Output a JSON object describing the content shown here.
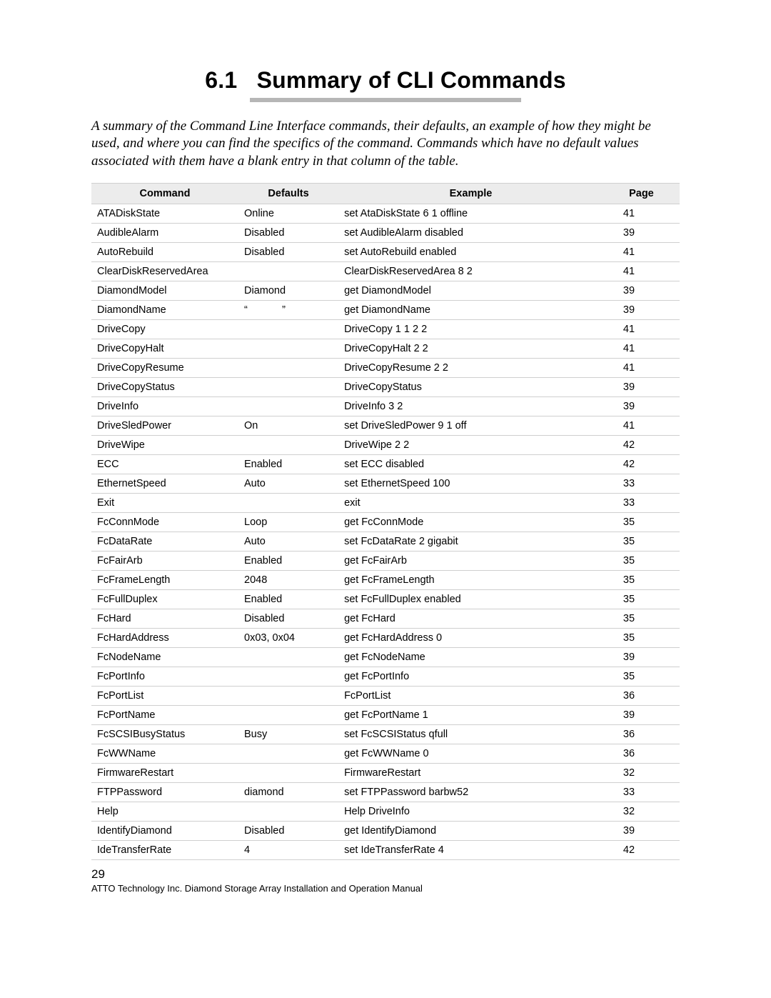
{
  "section": {
    "number": "6.1",
    "title": "Summary of CLI Commands"
  },
  "intro": "A summary of the Command Line Interface commands, their defaults, an example of how they might be used, and where you can find the specifics of the command. Commands which have no default values associated with them have a blank entry in that column of the table.",
  "table": {
    "headers": {
      "command": "Command",
      "defaults": "Defaults",
      "example": "Example",
      "page": "Page"
    },
    "rows": [
      {
        "command": "ATADiskState",
        "defaults": "Online",
        "example": "set AtaDiskState 6 1 offline",
        "page": "41"
      },
      {
        "command": "AudibleAlarm",
        "defaults": "Disabled",
        "example": "set AudibleAlarm disabled",
        "page": "39"
      },
      {
        "command": "AutoRebuild",
        "defaults": "Disabled",
        "example": "set AutoRebuild enabled",
        "page": "41"
      },
      {
        "command": "ClearDiskReservedArea",
        "defaults": "",
        "example": "ClearDiskReservedArea 8 2",
        "page": "41"
      },
      {
        "command": "DiamondModel",
        "defaults": "Diamond",
        "example": "get DiamondModel",
        "page": "39"
      },
      {
        "command": "DiamondName",
        "defaults": "“            ”",
        "example": "get DiamondName",
        "page": "39"
      },
      {
        "command": "DriveCopy",
        "defaults": "",
        "example": "DriveCopy 1 1 2 2",
        "page": "41"
      },
      {
        "command": "DriveCopyHalt",
        "defaults": "",
        "example": "DriveCopyHalt 2 2",
        "page": "41"
      },
      {
        "command": "DriveCopyResume",
        "defaults": "",
        "example": "DriveCopyResume 2 2",
        "page": "41"
      },
      {
        "command": "DriveCopyStatus",
        "defaults": "",
        "example": "DriveCopyStatus",
        "page": "39"
      },
      {
        "command": "DriveInfo",
        "defaults": "",
        "example": "DriveInfo 3 2",
        "page": "39"
      },
      {
        "command": "DriveSledPower",
        "defaults": "On",
        "example": "set DriveSledPower 9 1 off",
        "page": "41"
      },
      {
        "command": "DriveWipe",
        "defaults": "",
        "example": "DriveWipe 2 2",
        "page": "42"
      },
      {
        "command": "ECC",
        "defaults": "Enabled",
        "example": "set ECC disabled",
        "page": "42"
      },
      {
        "command": "EthernetSpeed",
        "defaults": "Auto",
        "example": "set EthernetSpeed 100",
        "page": "33"
      },
      {
        "command": "Exit",
        "defaults": "",
        "example": "exit",
        "page": "33"
      },
      {
        "command": "FcConnMode",
        "defaults": "Loop",
        "example": "get FcConnMode",
        "page": "35"
      },
      {
        "command": "FcDataRate",
        "defaults": "Auto",
        "example": "set FcDataRate 2 gigabit",
        "page": "35"
      },
      {
        "command": "FcFairArb",
        "defaults": "Enabled",
        "example": "get FcFairArb",
        "page": "35"
      },
      {
        "command": "FcFrameLength",
        "defaults": "2048",
        "example": "get FcFrameLength",
        "page": "35"
      },
      {
        "command": "FcFullDuplex",
        "defaults": "Enabled",
        "example": "set FcFullDuplex enabled",
        "page": "35"
      },
      {
        "command": "FcHard",
        "defaults": "Disabled",
        "example": "get FcHard",
        "page": "35"
      },
      {
        "command": "FcHardAddress",
        "defaults": "0x03, 0x04",
        "example": "get FcHardAddress 0",
        "page": "35"
      },
      {
        "command": "FcNodeName",
        "defaults": "",
        "example": "get FcNodeName",
        "page": "39"
      },
      {
        "command": "FcPortInfo",
        "defaults": "",
        "example": "get FcPortInfo",
        "page": "35"
      },
      {
        "command": "FcPortList",
        "defaults": "",
        "example": "FcPortList",
        "page": "36"
      },
      {
        "command": "FcPortName",
        "defaults": "",
        "example": "get FcPortName 1",
        "page": "39"
      },
      {
        "command": "FcSCSIBusyStatus",
        "defaults": "Busy",
        "example": "set FcSCSIStatus qfull",
        "page": "36"
      },
      {
        "command": "FcWWName",
        "defaults": "",
        "example": "get FcWWName 0",
        "page": "36"
      },
      {
        "command": "FirmwareRestart",
        "defaults": "",
        "example": "FirmwareRestart",
        "page": "32"
      },
      {
        "command": "FTPPassword",
        "defaults": "diamond",
        "example": "set FTPPassword barbw52",
        "page": "33"
      },
      {
        "command": "Help",
        "defaults": "",
        "example": "Help DriveInfo",
        "page": "32"
      },
      {
        "command": "IdentifyDiamond",
        "defaults": "Disabled",
        "example": "get IdentifyDiamond",
        "page": "39"
      },
      {
        "command": "IdeTransferRate",
        "defaults": "4",
        "example": "set IdeTransferRate 4",
        "page": "42"
      }
    ]
  },
  "footer": {
    "page_number": "29",
    "line": "ATTO Technology Inc. Diamond Storage Array Installation and Operation Manual"
  }
}
